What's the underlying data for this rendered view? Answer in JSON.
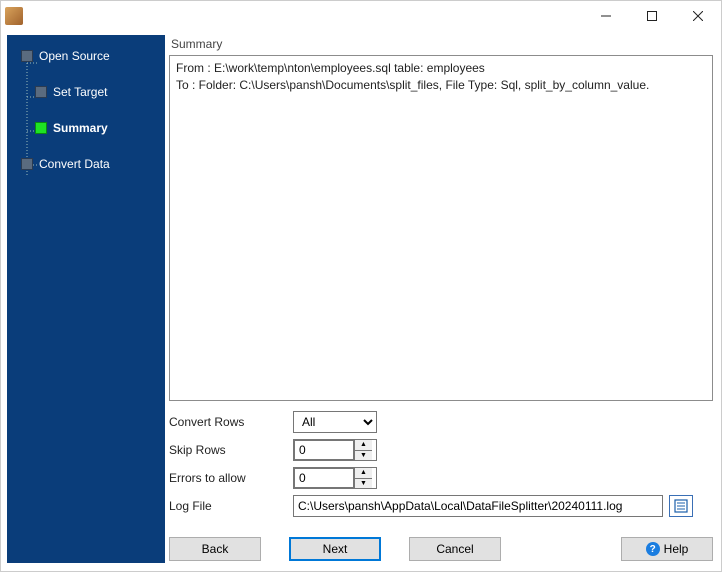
{
  "window": {
    "title": ""
  },
  "sidebar": {
    "items": [
      {
        "label": "Open Source",
        "active": false
      },
      {
        "label": "Set Target",
        "active": false
      },
      {
        "label": "Summary",
        "active": true
      },
      {
        "label": "Convert Data",
        "active": false
      }
    ]
  },
  "main": {
    "heading": "Summary",
    "summary_text": "From : E:\\work\\temp\\nton\\employees.sql table: employees\nTo : Folder: C:\\Users\\pansh\\Documents\\split_files, File Type: Sql, split_by_column_value."
  },
  "form": {
    "convert_rows_label": "Convert Rows",
    "convert_rows_value": "All",
    "skip_rows_label": "Skip Rows",
    "skip_rows_value": "0",
    "errors_label": "Errors to allow",
    "errors_value": "0",
    "logfile_label": "Log File",
    "logfile_value": "C:\\Users\\pansh\\AppData\\Local\\DataFileSplitter\\20240111.log"
  },
  "buttons": {
    "back": "Back",
    "next": "Next",
    "cancel": "Cancel",
    "help": "Help"
  }
}
